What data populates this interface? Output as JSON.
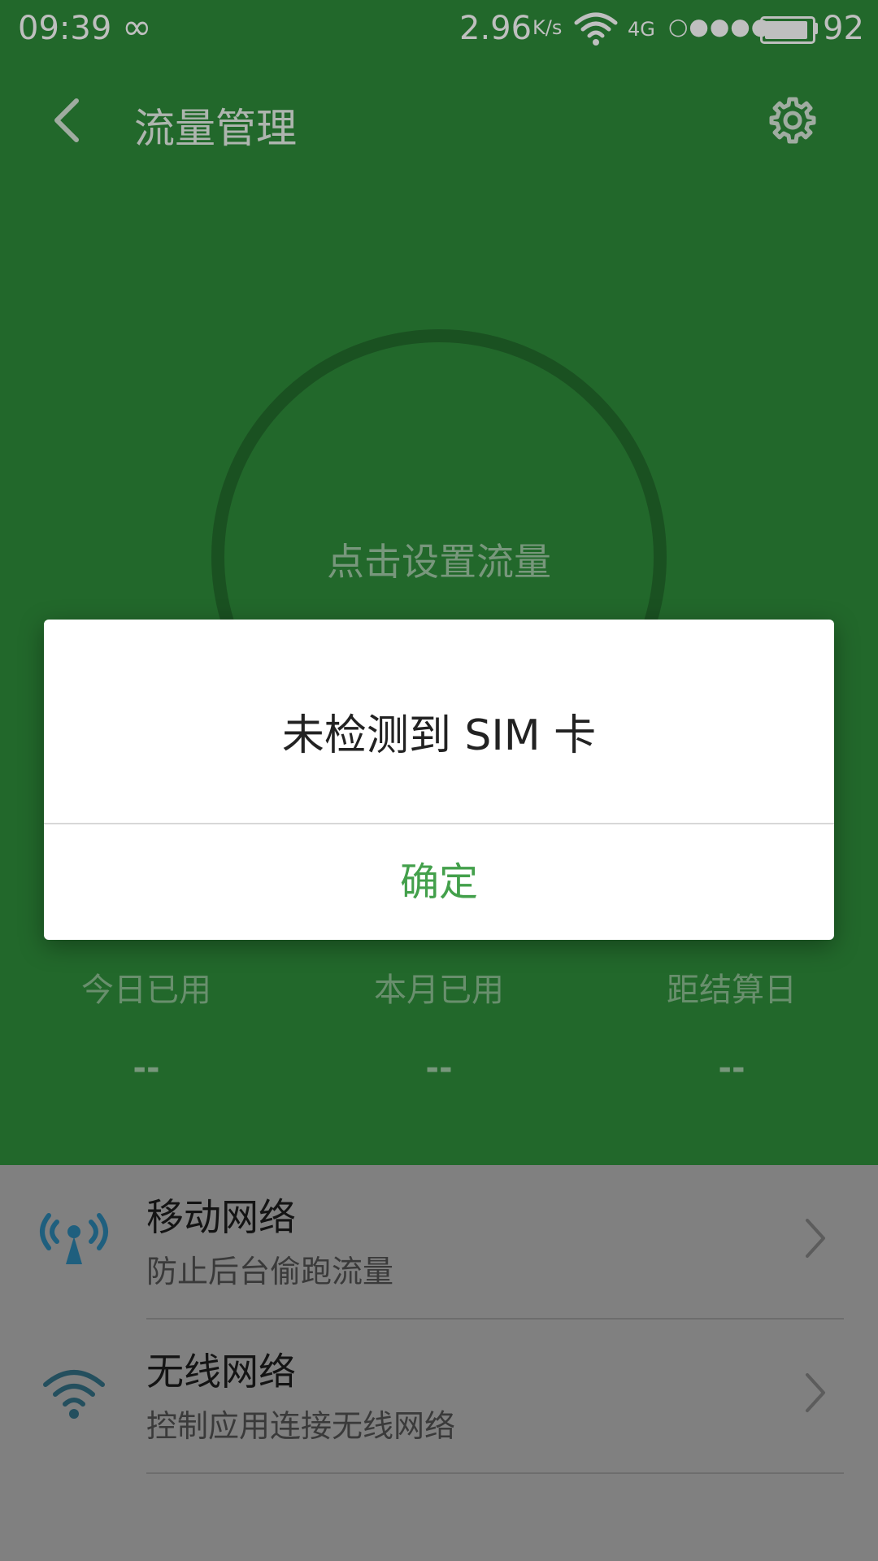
{
  "status_bar": {
    "time": "09:39",
    "infinity_symbol": "∞",
    "speed": "2.96",
    "speed_unit": "K/s",
    "network": "4G",
    "signal": "○●●●●",
    "battery": "92",
    "battery_level": 0.92
  },
  "app_bar": {
    "title": "流量管理",
    "back_icon": "back-icon",
    "settings_icon": "gear-icon"
  },
  "usage": {
    "center_text": "点击设置流量",
    "stats": [
      {
        "label": "今日已用",
        "value": "--"
      },
      {
        "label": "本月已用",
        "value": "--"
      },
      {
        "label": "距结算日",
        "value": "--"
      }
    ]
  },
  "list": {
    "items": [
      {
        "title": "移动网络",
        "subtitle": "防止后台偷跑流量",
        "icon": "antenna-icon"
      },
      {
        "title": "无线网络",
        "subtitle": "控制应用连接无线网络",
        "icon": "wifi-icon"
      }
    ]
  },
  "dialog": {
    "message": "未检测到 SIM 卡",
    "confirm": "确定"
  },
  "colors": {
    "green": "#2e8b3a",
    "accent": "#43a04b",
    "icon_blue": "#1f6f93"
  }
}
